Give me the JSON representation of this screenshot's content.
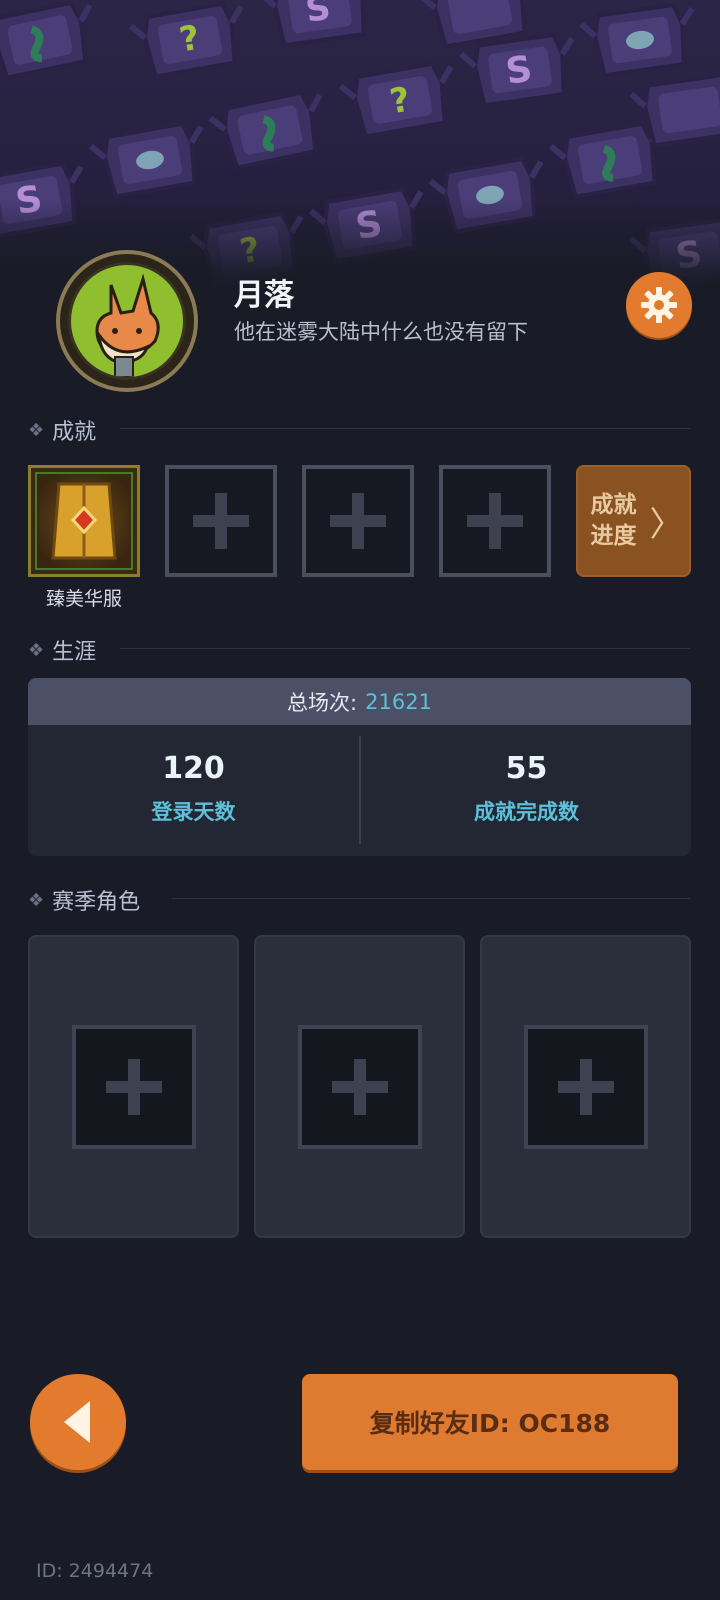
{
  "profile": {
    "username": "月落",
    "bio": "他在迷雾大陆中什么也没有留下"
  },
  "icons": {
    "settings": "gear-icon",
    "back": "triangle-left-icon",
    "add": "plus-icon"
  },
  "achievements": {
    "title": "成就",
    "equipped": [
      {
        "name": "臻美华服",
        "icon": "golden-robe-badge-icon"
      }
    ],
    "empty_slots": 3,
    "progress_label_line1": "成就",
    "progress_label_line2": "进度",
    "progress_chevron": "〉"
  },
  "career": {
    "title": "生涯",
    "total_label": "总场次:",
    "total_value": "21621",
    "stats": [
      {
        "value": "120",
        "label": "登录天数"
      },
      {
        "value": "55",
        "label": "成就完成数"
      }
    ]
  },
  "season": {
    "title": "赛季角色",
    "slots": 3
  },
  "actions": {
    "copy_friend_id": "复制好友ID: OC188"
  },
  "footer": {
    "player_id": "ID: 2494474"
  },
  "colors": {
    "accent_orange": "#e27b2d",
    "stat_cyan": "#5cc0d8",
    "background": "#191b26"
  }
}
